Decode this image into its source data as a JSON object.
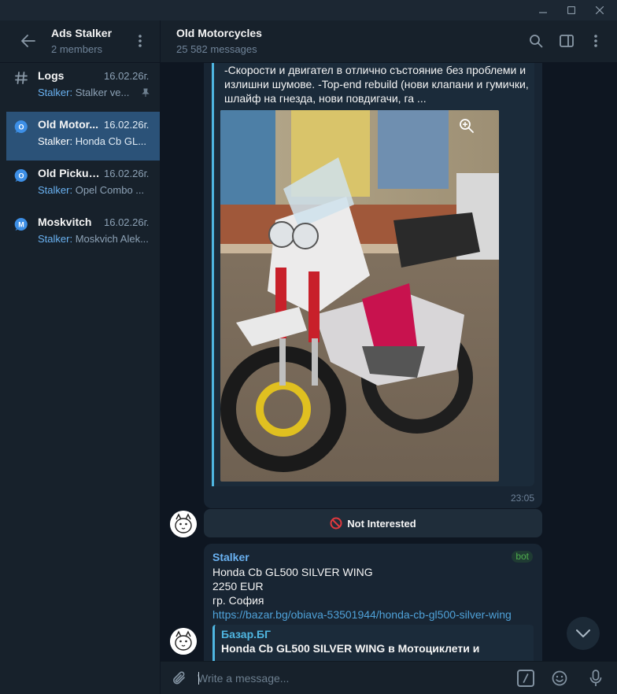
{
  "window": {
    "controls": [
      "minimize-icon",
      "maximize-icon",
      "close-icon"
    ]
  },
  "sidebar": {
    "title": "Ads Stalker",
    "subtitle": "2 members",
    "items": [
      {
        "icon": "hashtag-icon",
        "name": "Logs",
        "date": "16.02.26г.",
        "sender": "Stalker:",
        "preview": "Stalker ve...",
        "pinned": true
      },
      {
        "icon": "topic-icon",
        "icon_letter": "O",
        "icon_color": "#3d8fe6",
        "name": "Old Motor...",
        "date": "16.02.26г.",
        "sender": "Stalker:",
        "preview": "Honda Cb GL...",
        "active": true
      },
      {
        "icon": "topic-icon",
        "icon_letter": "O",
        "icon_color": "#3d8fe6",
        "name": "Old Pickups",
        "date": "16.02.26г.",
        "sender": "Stalker:",
        "preview": "Opel Combo ..."
      },
      {
        "icon": "topic-icon",
        "icon_letter": "M",
        "icon_color": "#3d8fe6",
        "name": "Moskvitch",
        "date": "16.02.26г.",
        "sender": "Stalker:",
        "preview": "Moskvich Alek..."
      }
    ]
  },
  "header": {
    "title": "Old Motorcycles",
    "subtitle": "25 582 messages"
  },
  "messages": {
    "first": {
      "text_line1": "-Скорости и двигател в отлично състояние без проблеми и",
      "text_line2": "излишни шумове.  -Top-end rebuild (нови клапани и гумички,",
      "text_line3": "шлайф на гнезда, нови повдигачи, га ...",
      "time": "23:05"
    },
    "keyboard_button": {
      "label": "Not Interested"
    },
    "second": {
      "sender": "Stalker",
      "badge": "bot",
      "line1": "Honda Cb GL500 SILVER WING",
      "line2": "2250 EUR",
      "line3": "гр. София",
      "link": "https://bazar.bg/obiava-53501944/honda-cb-gl500-silver-wing",
      "preview_site": "Базар.БГ",
      "preview_title": "Honda Cb GL500 SILVER WING в Мотоциклети и"
    }
  },
  "composer": {
    "placeholder": "Write a message..."
  },
  "colors": {
    "accent": "#6ab2f2",
    "active_chat": "#2b5278",
    "bubble": "#182533",
    "background": "#0e1621"
  }
}
